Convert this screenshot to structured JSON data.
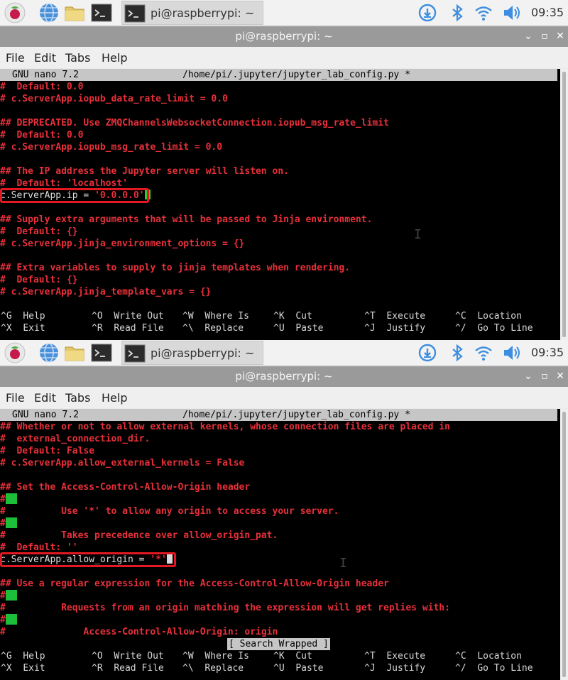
{
  "clock": "09:35",
  "taskbar_button": "pi@raspberrypi: ~",
  "window_title": "pi@raspberrypi: ~",
  "menu": [
    "File",
    "Edit",
    "Tabs",
    "Help"
  ],
  "nano": {
    "version": "GNU nano 7.2",
    "file": "/home/pi/.jupyter/jupyter_lab_config.py *"
  },
  "panel1": {
    "lines": [
      "#  Default: 0.0",
      "# c.ServerApp.iopub_data_rate_limit = 0.0",
      "",
      "## DEPRECATED. Use ZMQChannelsWebsocketConnection.iopub_msg_rate_limit",
      "#  Default: 0.0",
      "# c.ServerApp.iopub_msg_rate_limit = 0.0",
      "",
      "## The IP address the Jupyter server will listen on.",
      "#  Default: 'localhost'",
      "",
      "",
      "## Supply extra arguments that will be passed to Jinja environment.",
      "#  Default: {}",
      "# c.ServerApp.jinja_environment_options = {}",
      "",
      "## Extra variables to supply to jinja templates when rendering.",
      "#  Default: {}",
      "# c.ServerApp.jinja_template_vars = {}"
    ],
    "edited_prefix": "c.ServerApp.ip = ",
    "edited_value": "'0.0.0.0'"
  },
  "panel2": {
    "lines": [
      "## Whether or not to allow external kernels, whose connection files are placed in",
      "#  external_connection_dir.",
      "#  Default: False",
      "# c.ServerApp.allow_external_kernels = False",
      "",
      "## Set the Access-Control-Allow-Origin header",
      "#",
      "#          Use '*' to allow any origin to access your server.",
      "#",
      "#          Takes precedence over allow_origin_pat.",
      "#  Default: ''",
      "",
      "",
      "## Use a regular expression for the Access-Control-Allow-Origin header",
      "#",
      "#          Requests from an origin matching the expression will get replies with:",
      "#",
      "#              Access-Control-Allow-Origin: origin"
    ],
    "edited_prefix": "c.ServerApp.allow_origin = ",
    "edited_value": "'*'",
    "status": "[ Search Wrapped ]"
  },
  "shortcuts": [
    {
      "key": "^G",
      "label": "Help"
    },
    {
      "key": "^O",
      "label": "Write Out"
    },
    {
      "key": "^W",
      "label": "Where Is"
    },
    {
      "key": "^K",
      "label": "Cut"
    },
    {
      "key": "^T",
      "label": "Execute"
    },
    {
      "key": "^C",
      "label": "Location"
    },
    {
      "key": "^X",
      "label": "Exit"
    },
    {
      "key": "^R",
      "label": "Read File"
    },
    {
      "key": "^\\",
      "label": "Replace"
    },
    {
      "key": "^U",
      "label": "Paste"
    },
    {
      "key": "^J",
      "label": "Justify"
    },
    {
      "key": "^/",
      "label": "Go To Line"
    }
  ],
  "colors": {
    "terminal_bg": "#000000",
    "comment_red": "#e8303a",
    "highlight_box": "#e41820",
    "cursor_green": "#2ece2e"
  }
}
